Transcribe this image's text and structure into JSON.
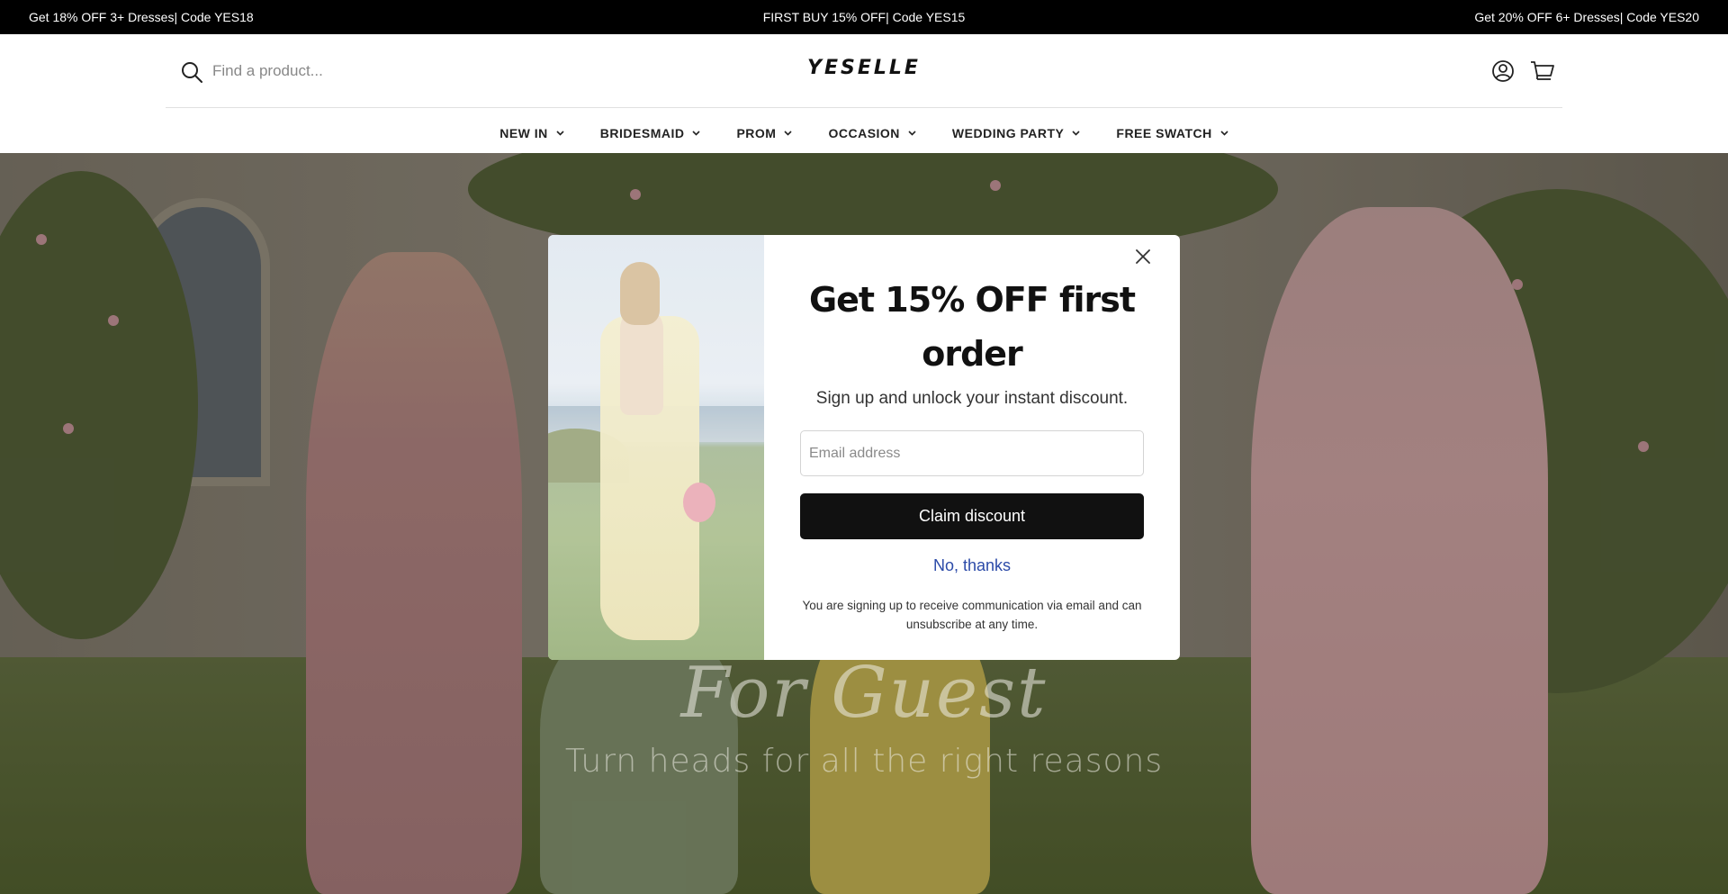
{
  "announcement": {
    "left": "Get 18% OFF 3+ Dresses| Code YES18",
    "center": "FIRST BUY 15% OFF| Code YES15",
    "right": "Get 20% OFF 6+ Dresses| Code YES20"
  },
  "header": {
    "search_placeholder": "Find a product...",
    "logo": "YESELLE",
    "icons": [
      "search-icon",
      "account-icon",
      "cart-icon"
    ]
  },
  "nav": {
    "items": [
      {
        "label": "NEW IN"
      },
      {
        "label": "BRIDESMAID"
      },
      {
        "label": "PROM"
      },
      {
        "label": "OCCASION"
      },
      {
        "label": "WEDDING PARTY"
      },
      {
        "label": "FREE SWATCH"
      }
    ]
  },
  "hero": {
    "script_text": "For Guest",
    "tagline": "Turn heads for all the right reasons"
  },
  "modal": {
    "title": "Get 15% OFF first order",
    "subtitle": "Sign up and unlock your instant discount.",
    "email_placeholder": "Email address",
    "claim_label": "Claim discount",
    "decline_label": "No, thanks",
    "disclaimer": "You are signing up to receive communication via email and can unsubscribe at any time."
  }
}
